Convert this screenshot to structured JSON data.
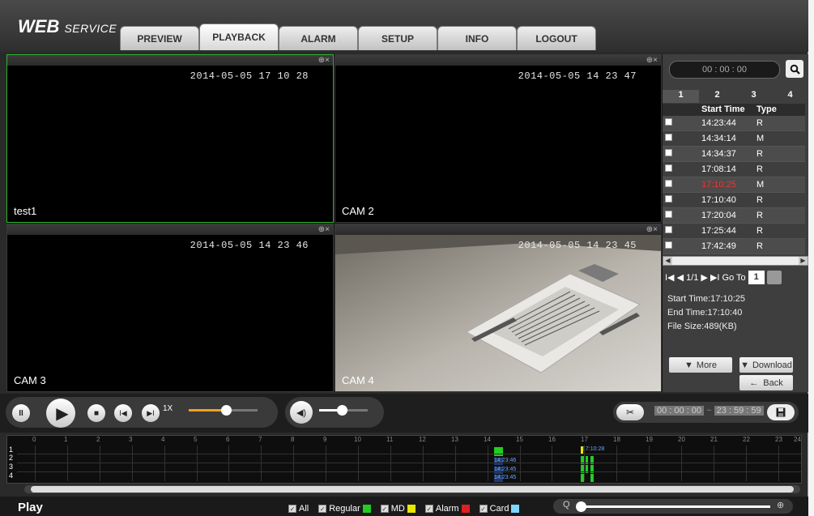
{
  "header": {
    "logo_main": "WEB",
    "logo_sub": "SERVICE",
    "tabs": [
      "PREVIEW",
      "PLAYBACK",
      "ALARM",
      "SETUP",
      "INFO",
      "LOGOUT"
    ],
    "active_tab": "PLAYBACK"
  },
  "panes": [
    {
      "timestamp": "2014-05-05 17 10 28",
      "label": "test1"
    },
    {
      "timestamp": "2014-05-05 14 23 47",
      "label": "CAM 2"
    },
    {
      "timestamp": "2014-05-05 14 23 46",
      "label": "CAM 3"
    },
    {
      "timestamp": "2014-05-05 14 23 45",
      "label": "CAM 4"
    }
  ],
  "pane_controls": "⊕×",
  "sidebar": {
    "time_value": "00 : 00 : 00",
    "day_tabs": [
      "1",
      "2",
      "3",
      "4"
    ],
    "col_start": "Start Time",
    "col_type": "Type",
    "files": [
      {
        "start": "14:23:44",
        "type": "R"
      },
      {
        "start": "14:34:14",
        "type": "M"
      },
      {
        "start": "14:34:37",
        "type": "R"
      },
      {
        "start": "17:08:14",
        "type": "R"
      },
      {
        "start": "17:10:25",
        "type": "M"
      },
      {
        "start": "17:10:40",
        "type": "R"
      },
      {
        "start": "17:20:04",
        "type": "R"
      },
      {
        "start": "17:25:44",
        "type": "R"
      },
      {
        "start": "17:42:49",
        "type": "R"
      }
    ],
    "pager_text": "I◀ ◀ 1/1 ▶ ▶I Go To",
    "page_value": "1",
    "info": {
      "start": "Start Time:17:10:25",
      "end": "End Time:17:10:40",
      "size": "File Size:489(KB)"
    },
    "more_label": "More",
    "download_label": "Download",
    "back_label": "Back"
  },
  "controls": {
    "speed": "1X",
    "clip_from": "00 : 00 : 00",
    "clip_sep": "~",
    "clip_to": "23 : 59 : 59"
  },
  "timeline": {
    "hours": [
      "0",
      "1",
      "2",
      "3",
      "4",
      "5",
      "6",
      "7",
      "8",
      "9",
      "10",
      "11",
      "12",
      "13",
      "14",
      "15",
      "16",
      "17",
      "18",
      "19",
      "20",
      "21",
      "22",
      "23",
      "24"
    ],
    "channels": [
      "1",
      "2",
      "3",
      "4"
    ],
    "marker_top": "17:10:28",
    "markers": [
      "14:23:46",
      "14:23:45",
      "14:23:45"
    ]
  },
  "bottom": {
    "play_label": "Play",
    "legend": [
      {
        "label": "All",
        "color": ""
      },
      {
        "label": "Regular",
        "color": "#22cc22"
      },
      {
        "label": "MD",
        "color": "#e8e800"
      },
      {
        "label": "Alarm",
        "color": "#e02020"
      },
      {
        "label": "Card",
        "color": "#7fd7ff"
      }
    ]
  }
}
